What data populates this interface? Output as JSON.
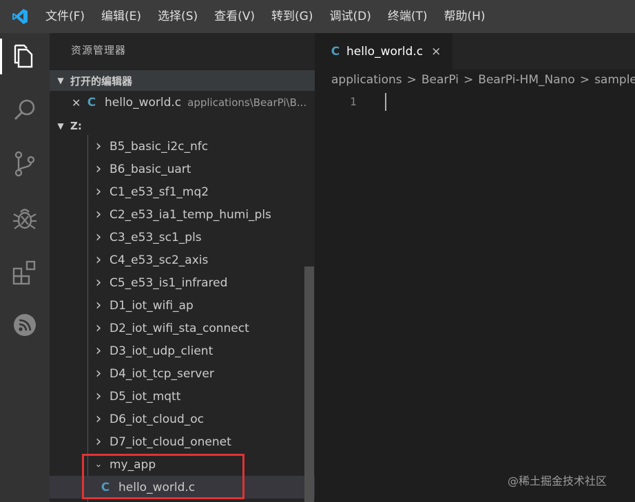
{
  "menu": [
    "文件(F)",
    "编辑(E)",
    "选择(S)",
    "查看(V)",
    "转到(G)",
    "调试(D)",
    "终端(T)",
    "帮助(H)"
  ],
  "activity_bar": [
    "explorer-icon",
    "search-icon",
    "source-control-icon",
    "debug-icon",
    "extensions-icon",
    "device-icon"
  ],
  "sidebar": {
    "title": "资源管理器",
    "open_editors": {
      "header": "打开的编辑器",
      "file_icon": "C",
      "file_name": "hello_world.c",
      "file_path": "applications\\BearPi\\B..."
    },
    "root": {
      "header": "Z:"
    },
    "tree": [
      "B5_basic_i2c_nfc",
      "B6_basic_uart",
      "C1_e53_sf1_mq2",
      "C2_e53_ia1_temp_humi_pls",
      "C3_e53_sc1_pls",
      "C4_e53_sc2_axis",
      "C5_e53_is1_infrared",
      "D1_iot_wifi_ap",
      "D2_iot_wifi_sta_connect",
      "D3_iot_udp_client",
      "D4_iot_tcp_server",
      "D5_iot_mqtt",
      "D6_iot_cloud_oc",
      "D7_iot_cloud_onenet"
    ],
    "expanded_folder": "my_app",
    "selected_file_icon": "C",
    "selected_file": "hello_world.c"
  },
  "editor": {
    "tab_icon": "C",
    "tab_label": "hello_world.c",
    "tab_close": "×",
    "breadcrumb": [
      "applications",
      "BearPi",
      "BearPi-HM_Nano",
      "sample"
    ],
    "line_number": "1"
  },
  "watermark": "@稀土掘金技术社区",
  "colors": {
    "accent_blue": "#007acc",
    "c_icon": "#519aba",
    "highlight_box": "#e33232"
  }
}
